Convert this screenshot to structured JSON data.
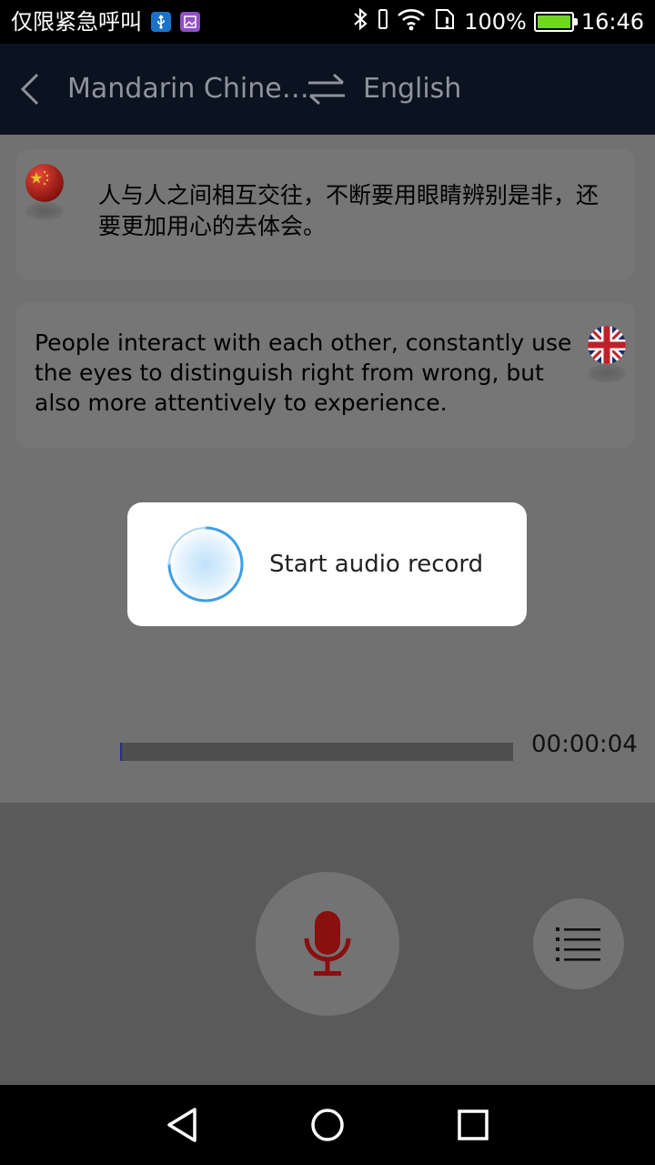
{
  "status_bar": {
    "carrier": "仅限紧急呼叫",
    "battery": "100%",
    "time": "16:46"
  },
  "header": {
    "source_language": "Mandarin Chine…",
    "target_language": "English"
  },
  "conversation": {
    "source_text": "人与人之间相互交往，不断要用眼睛辨别是非，还要更加用心的去体会。",
    "translated_text": "People interact with each other, constantly use the eyes to distinguish right from wrong, but also more attentively to experience."
  },
  "recording": {
    "elapsed": "00:00:04",
    "progress_fraction": 0.005,
    "progress_color": "#23308a"
  },
  "dialog": {
    "message": "Start audio record"
  },
  "colors": {
    "mic_accent": "#8a0f0f",
    "header_bg": "#0b1220"
  },
  "icons": [
    "back-chevron-icon",
    "swap-arrows-icon",
    "china-flag-icon",
    "uk-flag-icon",
    "microphone-icon",
    "list-menu-icon",
    "bluetooth-icon",
    "wifi-icon",
    "battery-icon"
  ]
}
